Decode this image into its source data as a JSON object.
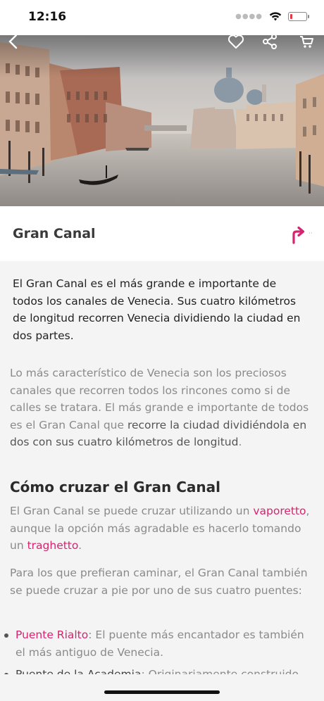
{
  "status_bar": {
    "time": "12:16",
    "icons": [
      "signal-dots",
      "wifi-icon",
      "battery-icon"
    ],
    "battery_level": 0.15,
    "battery_color": "#e63946"
  },
  "hero": {
    "icons": [
      "back-icon",
      "heart-icon",
      "share-icon",
      "cart-icon"
    ]
  },
  "header": {
    "title": "Gran Canal",
    "accent_color": "#d6246e",
    "more_indicator": "··"
  },
  "content": {
    "lead": "El Gran Canal es el más grande e importante de todos los canales de Venecia. Sus cuatro kilómetros de longitud recorren Venecia dividiendo la ciudad en dos partes.",
    "para1": {
      "text_a": "Lo más característico de Venecia son los preciosos canales que recorren todos los rincones como si de calles se tratara. El más grande e importante de todos es el Gran Canal que ",
      "bold": "recorre la ciudad dividiéndola en dos con sus cuatro kilómetros de longitud",
      "text_b": "."
    },
    "heading": "Cómo cruzar el Gran Canal",
    "para2": {
      "text_a": "El Gran Canal se puede cruzar utilizando un ",
      "link1": "vaporetto",
      "text_b": ", aunque la opción más agradable es hacerlo tomando un ",
      "link2": "traghetto",
      "text_c": "."
    },
    "para3": "Para los que prefieran caminar, el Gran Canal también se puede cruzar a pie por uno de sus cuatro puentes:",
    "bullets": [
      {
        "link": "Puente Rialto",
        "text": ": El puente más encantador es también el más antiguo de Venecia."
      },
      {
        "link": "Puente de la Academia",
        "text": ": Originariamente construido"
      }
    ]
  }
}
